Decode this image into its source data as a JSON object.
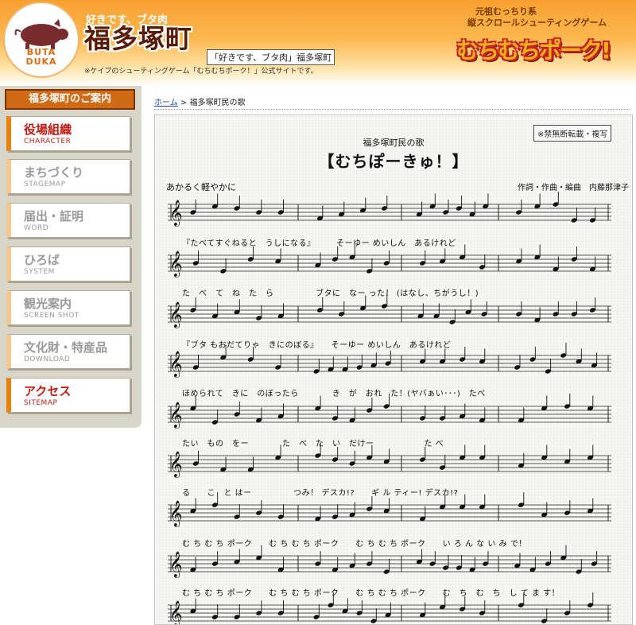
{
  "header": {
    "logo_text": "BUTA\nDUKA",
    "tagline": "好きです、ブタ肉",
    "site_title": "福多塚町",
    "title_box": "「好きです、ブタ肉」福多塚町",
    "note": "※ケイブのシューティングゲーム「むちむちポーク！」公式サイトです。",
    "promo_line1": "元祖むっちり系",
    "promo_line2": "縦スクロールシューティングゲーム",
    "game_logo": "むちむちポーク!"
  },
  "sidebar": {
    "heading": "福多塚町のご案内",
    "items": [
      {
        "jp": "役場組織",
        "en": "CHARACTER",
        "state": "on"
      },
      {
        "jp": "まちづくり",
        "en": "STAGEMAP",
        "state": "off"
      },
      {
        "jp": "届出・証明",
        "en": "WORD",
        "state": "off"
      },
      {
        "jp": "ひろば",
        "en": "SYSTEM",
        "state": "off"
      },
      {
        "jp": "観光案内",
        "en": "SCREEN SHOT",
        "state": "off"
      },
      {
        "jp": "文化財・特産品",
        "en": "DOWNLOAD",
        "state": "off"
      },
      {
        "jp": "アクセス",
        "en": "SITEMAP",
        "state": "on"
      }
    ]
  },
  "breadcrumb": {
    "home": "ホーム",
    "sep": ">",
    "current": "福多塚町民の歌"
  },
  "sheet": {
    "badge": "※禁無断転載・複写",
    "subtitle": "福多塚町民の歌",
    "title": "【むちぽーきゅ！】",
    "tempo": "あかるく軽やかに",
    "credits": "作詞・作曲・編曲　内藤那津子",
    "lyrics": [
      "『たべてすぐねると　うしになる』　　　そーゆー めいしん　あるけれど",
      "た　べ　て　ね　た　ら　　　　　ブタに　なー った！ (はなし、ちがうし！)",
      "『ブタ もおだてりゃ　きにのぼる』　　そーゆー めいしん　あるけれど",
      "ほめられて　きに　のぼったら　　　　き　が　おれ　た！(ヤバぁい･･･)　たべ",
      "たい　もの　をー　　　　た　べ　た　い　だけー　　　　　　た べ",
      "る　　こ　と はー　　　　　つみ！ デスカ!?　　ギ ル ティー! デスカ!?",
      "む ち む ち ポーク　　む ち む ち ポーク　　む ち む ち ポーク　　い ろ ん な い み で！",
      "む ち む ち ポーク　　む ち む ち ポーク　　む ち む ち ポーク　　む　ち　む　ち　し て ま す！"
    ]
  }
}
